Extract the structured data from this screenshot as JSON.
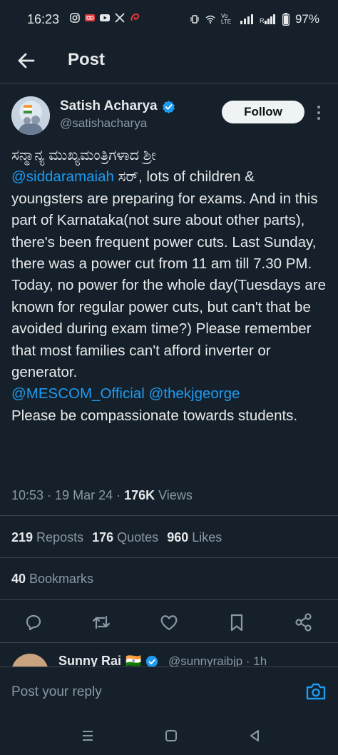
{
  "status_bar": {
    "time": "16:23",
    "battery": "97%",
    "network_label": "Vo LTE"
  },
  "header": {
    "title": "Post"
  },
  "author": {
    "name": "Satish Acharya",
    "handle": "@satishacharya",
    "follow_label": "Follow"
  },
  "tweet": {
    "kannada_greeting": "ಸನ್ಮಾನ್ಯ ಮುಖ್ಯಮಂತ್ರಿಗಳಾದ ಶ್ರೀ",
    "mention1": "@siddaramaiah",
    "kannada_sir": " ಸರ್",
    "text1": ", lots of children & youngsters are preparing for exams. And in this part of Karnataka(not sure about other parts), there's been frequent power cuts. Last Sunday, there was a power cut from 11 am till 7.30 PM. Today, no power for the whole day(Tuesdays are known for regular power cuts, but can't that be avoided during exam time?) Please remember that most families can't afford inverter or generator.",
    "mention2": "@MESCOM_Official",
    "mention3": "@thekjgeorge",
    "text2": "Please be compassionate towards students."
  },
  "meta": {
    "time": "10:53",
    "sep": " · ",
    "date": "19 Mar 24",
    "views_count": "176K",
    "views_label": " Views"
  },
  "stats": {
    "reposts_count": "219",
    "reposts_label": "Reposts",
    "quotes_count": "176",
    "quotes_label": "Quotes",
    "likes_count": "960",
    "likes_label": "Likes",
    "bookmarks_count": "40",
    "bookmarks_label": "Bookmarks"
  },
  "reply_preview": {
    "name": "Sunny Rai",
    "flag": "🇮🇳",
    "handle_time": "@sunnyraibjp · 1h"
  },
  "composer": {
    "placeholder": "Post your reply"
  },
  "colors": {
    "background": "#15202b",
    "accent": "#1d9bf0",
    "muted": "#8b98a5",
    "text": "#e7e9ea"
  }
}
